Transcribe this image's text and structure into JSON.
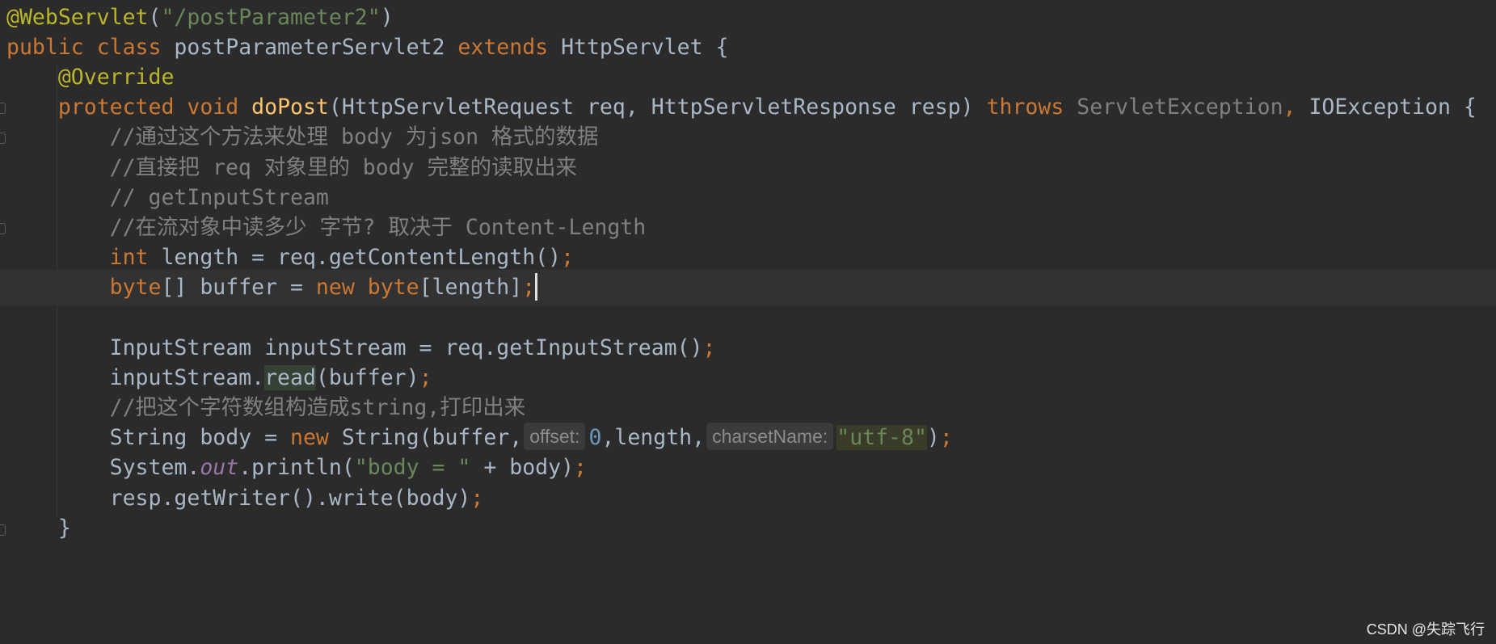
{
  "code": {
    "l1": {
      "annotation": "@WebServlet",
      "paren_open": "(",
      "path": "\"/postParameter2\"",
      "paren_close": ")"
    },
    "l2": {
      "kw_public": "public ",
      "kw_class": "class ",
      "class_name": "postParameterServlet2 ",
      "kw_extends": "extends ",
      "super_class": "HttpServlet {"
    },
    "l3": {
      "indent": "    ",
      "annotation": "@Override"
    },
    "l4": {
      "indent": "    ",
      "kw_protected": "protected ",
      "kw_void": "void ",
      "method": "doPost",
      "params": "(HttpServletRequest req, HttpServletResponse resp) ",
      "kw_throws": "throws ",
      "exc1": "ServletException",
      "comma": ", ",
      "exc2": "IOException {"
    },
    "l5": {
      "indent": "        ",
      "comment": "//通过这个方法来处理 body 为json 格式的数据"
    },
    "l6": {
      "indent": "        ",
      "comment": "//直接把 req 对象里的 body 完整的读取出来"
    },
    "l7": {
      "indent": "        ",
      "comment": "// getInputStream"
    },
    "l8": {
      "indent": "        ",
      "comment": "//在流对象中读多少 字节? 取决于 Content-Length"
    },
    "l9": {
      "indent": "        ",
      "kw_int": "int ",
      "rest": "length = req.getContentLength()",
      "semi": ";"
    },
    "l10": {
      "indent": "        ",
      "kw_byte": "byte",
      "mid": "[] buffer = ",
      "kw_new": "new ",
      "kw_byte2": "byte",
      "rest": "[length]",
      "semi": ";"
    },
    "l11": {
      "text": ""
    },
    "l12": {
      "indent": "        ",
      "text": "InputStream inputStream = req.getInputStream()",
      "semi": ";"
    },
    "l13": {
      "indent": "        ",
      "obj": "inputStream.",
      "method": "read",
      "rest": "(buffer)",
      "semi": ";"
    },
    "l14": {
      "indent": "        ",
      "comment": "//把这个字符数组构造成string,打印出来"
    },
    "l15": {
      "indent": "        ",
      "pre": "String body = ",
      "kw_new": "new ",
      "ctor": "String(buffer,",
      "hint_offset": "offset:",
      "zero": "0",
      "mid": ",length,",
      "hint_charset": "charsetName:",
      "charset": "\"utf-8\"",
      "close": ")",
      "semi": ";"
    },
    "l16": {
      "indent": "        ",
      "pre": "System.",
      "out": "out",
      "call": ".println(",
      "str": "\"body = \"",
      "rest": " + body)",
      "semi": ";"
    },
    "l17": {
      "indent": "        ",
      "text": "resp.getWriter().write(body)",
      "semi": ";"
    },
    "l18": {
      "indent": "    ",
      "brace": "}"
    }
  },
  "watermark": "CSDN @失踪飞行"
}
